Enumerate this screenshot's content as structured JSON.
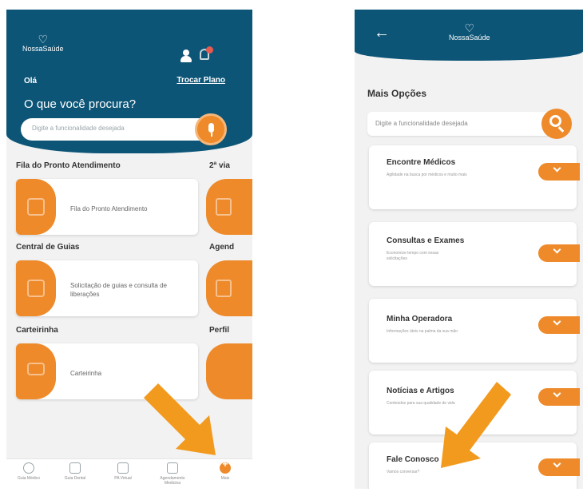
{
  "left": {
    "brand": "NossaSaúde",
    "greeting": "Olá",
    "trocar_plano": "Trocar Plano",
    "question": "O que você procura?",
    "search_placeholder": "Digite a funcionalidade desejada",
    "sections": [
      {
        "title": "Fila do Pronto Atendimento",
        "side_title": "2ª via",
        "card_text": "Fila do Pronto Atendimento"
      },
      {
        "title": "Central de Guias",
        "side_title": "Agend",
        "card_text": "Solicitação de guias e consulta de liberações"
      },
      {
        "title": "Carteirinha",
        "side_title": "Perfil",
        "card_text": "Carteirinha"
      }
    ],
    "nav": [
      {
        "label": "Guia Médico"
      },
      {
        "label": "Guia Dental"
      },
      {
        "label": "PA Virtual"
      },
      {
        "label": "Agendamento Medicina"
      },
      {
        "label": "Mais"
      }
    ]
  },
  "right": {
    "brand": "NossaSaúde",
    "section_title": "Mais Opções",
    "search_placeholder": "Digite a funcionalidade desejada",
    "options": [
      {
        "title": "Encontre Médicos",
        "subtitle": "Agilidade na busca por médicos e muito mais"
      },
      {
        "title": "Consultas e Exames",
        "subtitle": "Economize tempo com essas solicitações"
      },
      {
        "title": "Minha Operadora",
        "subtitle": "Informações úteis na palma da sua mão"
      },
      {
        "title": "Notícias e Artigos",
        "subtitle": "Conteúdos para sua qualidade de vida"
      },
      {
        "title": "Fale Conosco",
        "subtitle": "Vamos conversar?"
      }
    ]
  },
  "colors": {
    "primary": "#0d5577",
    "accent": "#ee8a2a",
    "arrow": "#f29a1e"
  },
  "icons": [
    "heart-logo-icon",
    "user-icon",
    "bell-icon",
    "mic-icon",
    "search-icon",
    "chevron-down-icon",
    "back-arrow-icon"
  ]
}
